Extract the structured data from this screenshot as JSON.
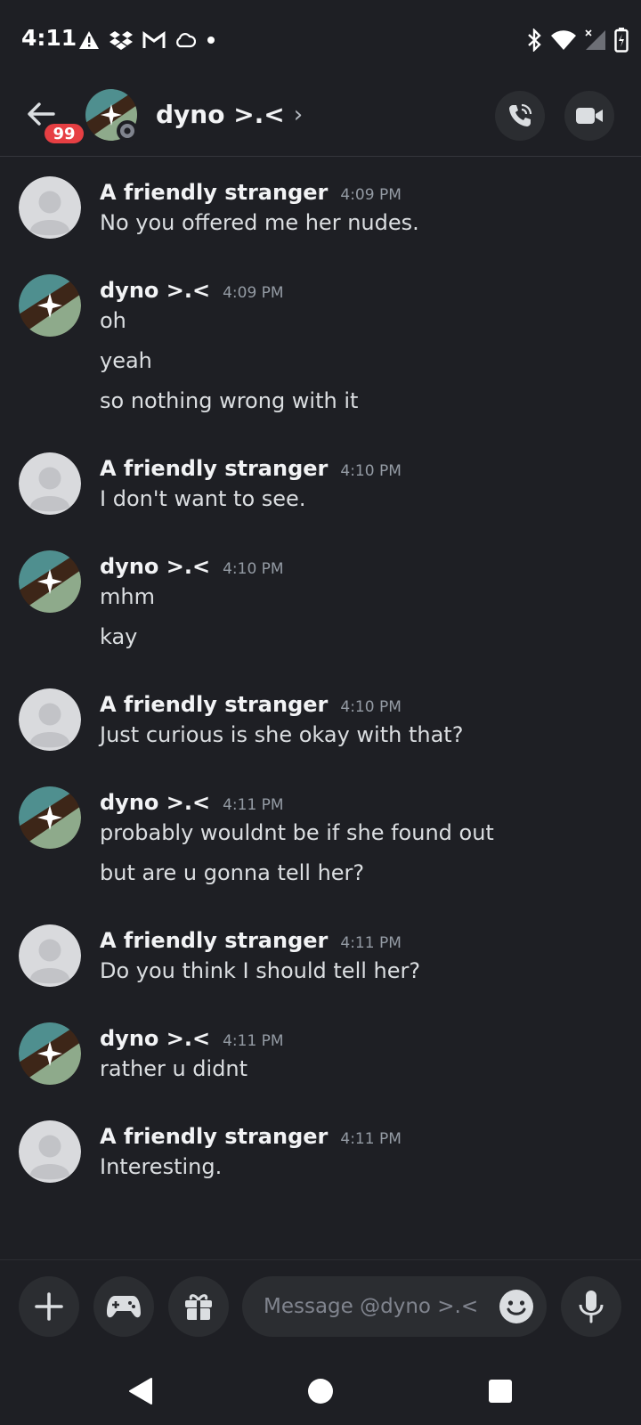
{
  "status_bar": {
    "time": "4:11",
    "icons": [
      "warning-icon",
      "dropbox-icon",
      "gmail-icon",
      "cloud-icon",
      "dot-icon",
      "bluetooth-icon",
      "wifi-icon",
      "signal-icon",
      "battery-icon"
    ]
  },
  "header": {
    "badge": "99",
    "title": "dyno >.<",
    "chevron": "›",
    "icons": [
      "back-arrow-icon",
      "voice-call-icon",
      "video-call-icon"
    ]
  },
  "messages": [
    {
      "author": "A friendly stranger",
      "time": "4:09 PM",
      "avatar": "default-avatar",
      "lines": [
        "No you offered me her nudes."
      ]
    },
    {
      "author": "dyno >.<",
      "time": "4:09 PM",
      "avatar": "sparkle-avatar",
      "lines": [
        "oh",
        "yeah",
        "so nothing wrong with it"
      ]
    },
    {
      "author": "A friendly stranger",
      "time": "4:10 PM",
      "avatar": "default-avatar",
      "lines": [
        "I don't want to see."
      ]
    },
    {
      "author": "dyno >.<",
      "time": "4:10 PM",
      "avatar": "sparkle-avatar",
      "lines": [
        "mhm",
        "kay"
      ]
    },
    {
      "author": "A friendly stranger",
      "time": "4:10 PM",
      "avatar": "default-avatar",
      "lines": [
        "Just curious is she okay with that?"
      ]
    },
    {
      "author": "dyno >.<",
      "time": "4:11 PM",
      "avatar": "sparkle-avatar",
      "lines": [
        "probably wouldnt be if she found out",
        "but are u gonna tell her?"
      ]
    },
    {
      "author": "A friendly stranger",
      "time": "4:11 PM",
      "avatar": "default-avatar",
      "lines": [
        "Do you think I should tell her?"
      ]
    },
    {
      "author": "dyno >.<",
      "time": "4:11 PM",
      "avatar": "sparkle-avatar",
      "lines": [
        "rather u didnt"
      ]
    },
    {
      "author": "A friendly stranger",
      "time": "4:11 PM",
      "avatar": "default-avatar",
      "lines": [
        "Interesting."
      ]
    }
  ],
  "composer": {
    "placeholder": "Message @dyno >.<",
    "icons": [
      "plus-icon",
      "gamepad-icon",
      "gift-icon",
      "emoji-icon",
      "microphone-icon"
    ]
  },
  "nav_bar": {
    "icons": [
      "nav-back-icon",
      "nav-home-icon",
      "nav-recents-icon"
    ]
  },
  "colors": {
    "background": "#1e1f24",
    "surface": "#2b2d31",
    "badge": "#e63f43",
    "author": "#f2f3f5",
    "timestamp": "#949ba4"
  }
}
